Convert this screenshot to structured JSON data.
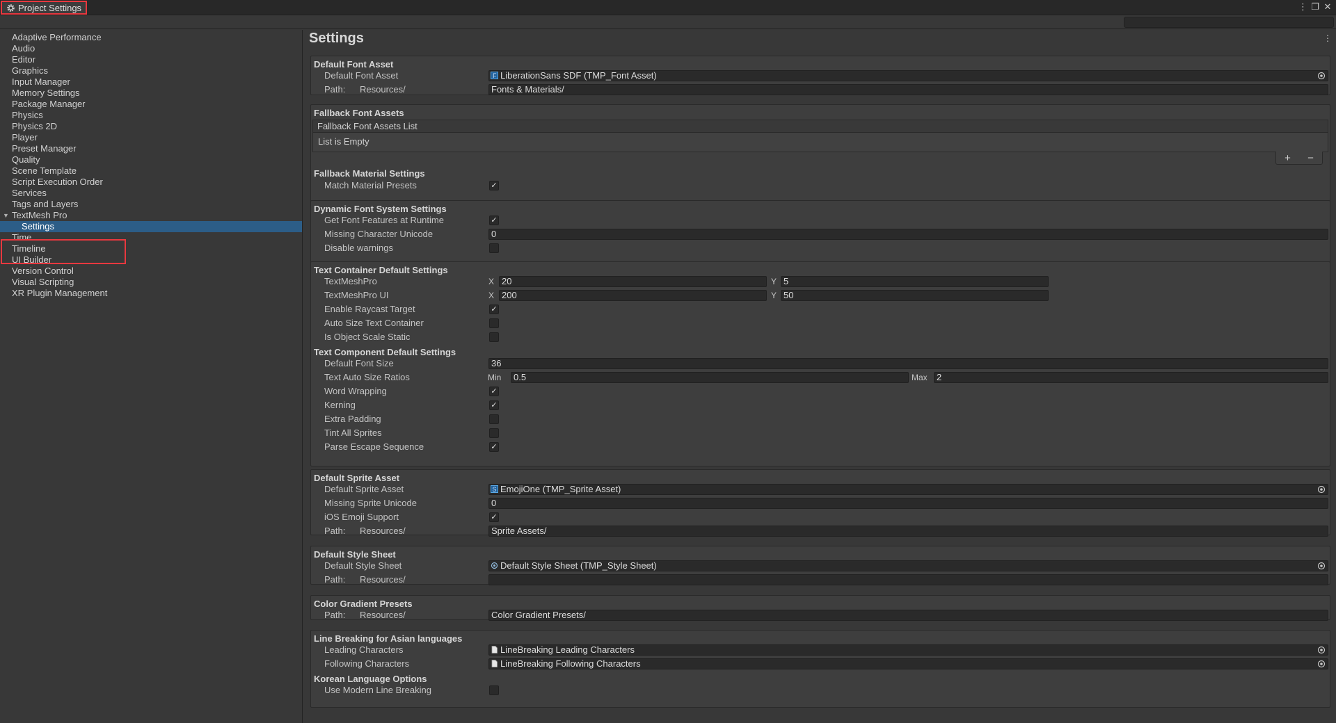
{
  "window": {
    "title": "Project Settings"
  },
  "toolbar": {
    "search_placeholder": ""
  },
  "sidebar": {
    "items": [
      {
        "label": "Adaptive Performance"
      },
      {
        "label": "Audio"
      },
      {
        "label": "Editor"
      },
      {
        "label": "Graphics"
      },
      {
        "label": "Input Manager"
      },
      {
        "label": "Memory Settings"
      },
      {
        "label": "Package Manager"
      },
      {
        "label": "Physics"
      },
      {
        "label": "Physics 2D"
      },
      {
        "label": "Player"
      },
      {
        "label": "Preset Manager"
      },
      {
        "label": "Quality"
      },
      {
        "label": "Scene Template"
      },
      {
        "label": "Script Execution Order"
      },
      {
        "label": "Services"
      },
      {
        "label": "Tags and Layers"
      },
      {
        "label": "TextMesh Pro"
      },
      {
        "label": "Settings"
      },
      {
        "label": "Time"
      },
      {
        "label": "Timeline"
      },
      {
        "label": "UI Builder"
      },
      {
        "label": "Version Control"
      },
      {
        "label": "Visual Scripting"
      },
      {
        "label": "XR Plugin Management"
      }
    ]
  },
  "main": {
    "title": "Settings",
    "default_font_asset": {
      "title": "Default Font Asset",
      "asset_label": "Default Font Asset",
      "asset_value": "LiberationSans SDF (TMP_Font Asset)",
      "path_label": "Path:",
      "path_prefix": "Resources/",
      "path_value": "Fonts & Materials/"
    },
    "fallback_font_assets": {
      "title": "Fallback Font Assets",
      "list_header": "Fallback Font Assets List",
      "list_empty": "List is Empty",
      "add": "+",
      "remove": "−"
    },
    "fallback_material": {
      "title": "Fallback Material Settings",
      "match_label": "Match Material Presets",
      "match_checked": true
    },
    "dynamic_font": {
      "title": "Dynamic Font System Settings",
      "features_label": "Get Font Features at Runtime",
      "features_checked": true,
      "missing_label": "Missing Character Unicode",
      "missing_value": "0",
      "warnings_label": "Disable warnings",
      "warnings_checked": false
    },
    "text_container": {
      "title": "Text Container Default Settings",
      "tmp_label": "TextMeshPro",
      "tmp_x": "20",
      "tmp_y": "5",
      "tmpui_label": "TextMeshPro UI",
      "tmpui_x": "200",
      "tmpui_y": "50",
      "x_label": "X",
      "y_label": "Y",
      "raycast_label": "Enable Raycast Target",
      "raycast_checked": true,
      "autosize_label": "Auto Size Text Container",
      "autosize_checked": false,
      "scale_label": "Is Object Scale Static",
      "scale_checked": false
    },
    "text_component": {
      "title": "Text Component Default Settings",
      "font_size_label": "Default Font Size",
      "font_size_value": "36",
      "ratios_label": "Text Auto Size Ratios",
      "min_label": "Min",
      "min_value": "0.5",
      "max_label": "Max",
      "max_value": "2",
      "wrap_label": "Word Wrapping",
      "wrap_checked": true,
      "kerning_label": "Kerning",
      "kerning_checked": true,
      "padding_label": "Extra Padding",
      "padding_checked": false,
      "tint_label": "Tint All Sprites",
      "tint_checked": false,
      "escape_label": "Parse Escape Sequence",
      "escape_checked": true
    },
    "default_sprite": {
      "title": "Default Sprite Asset",
      "asset_label": "Default Sprite Asset",
      "asset_value": "EmojiOne (TMP_Sprite Asset)",
      "missing_label": "Missing Sprite Unicode",
      "missing_value": "0",
      "ios_label": "iOS Emoji Support",
      "ios_checked": true,
      "path_label": "Path:",
      "path_prefix": "Resources/",
      "path_value": "Sprite Assets/"
    },
    "default_style": {
      "title": "Default Style Sheet",
      "sheet_label": "Default Style Sheet",
      "sheet_value": "Default Style Sheet (TMP_Style Sheet)",
      "path_label": "Path:",
      "path_prefix": "Resources/",
      "path_value": ""
    },
    "color_gradient": {
      "title": "Color Gradient Presets",
      "path_label": "Path:",
      "path_prefix": "Resources/",
      "path_value": "Color Gradient Presets/"
    },
    "line_breaking": {
      "title": "Line Breaking for Asian languages",
      "leading_label": "Leading Characters",
      "leading_value": "LineBreaking Leading Characters",
      "following_label": "Following Characters",
      "following_value": "LineBreaking Following Characters",
      "korean_title": "Korean Language Options",
      "modern_label": "Use Modern Line Breaking",
      "modern_checked": false
    }
  },
  "colors": {
    "accent": "#2c5d87",
    "highlight": "#e8383f",
    "background": "#383838"
  }
}
